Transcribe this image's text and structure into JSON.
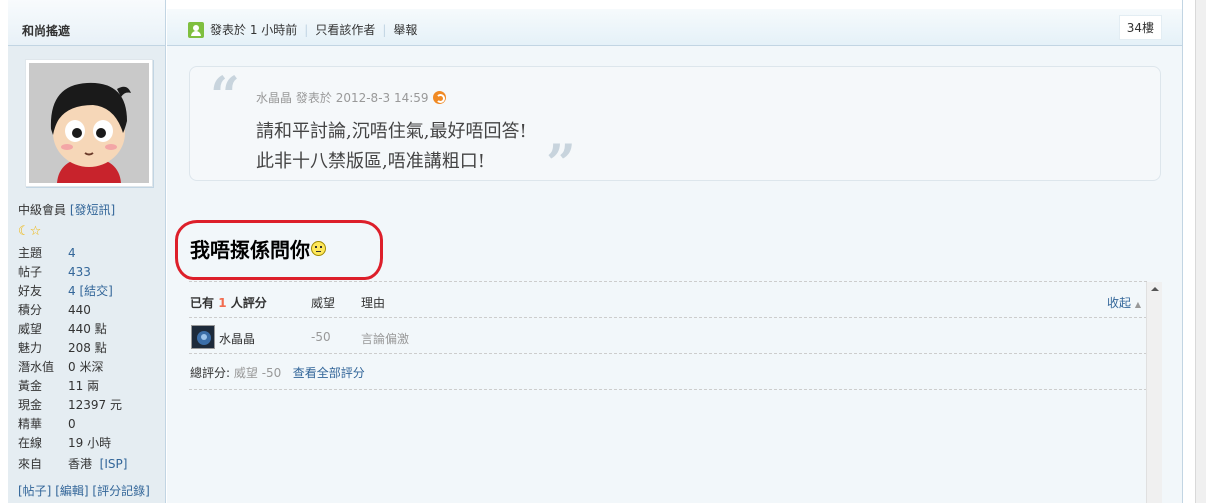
{
  "author": {
    "name": "和尚搖遮",
    "rank": "中級會員",
    "pm_link": "[發短訊]",
    "stats": [
      {
        "key": "主題",
        "value": "4",
        "link": true
      },
      {
        "key": "帖子",
        "value": "433",
        "link": true
      },
      {
        "key": "好友",
        "value": "4",
        "link": true,
        "extra": "[結交]"
      },
      {
        "key": "積分",
        "value": "440",
        "link": false
      },
      {
        "key": "威望",
        "value": "440 點",
        "link": false
      },
      {
        "key": "魅力",
        "value": "208 點",
        "link": false
      },
      {
        "key": "潛水值",
        "value": "0 米深",
        "link": false
      },
      {
        "key": "黃金",
        "value": "11 兩",
        "link": false
      },
      {
        "key": "現金",
        "value": "12397 元",
        "link": false
      },
      {
        "key": "精華",
        "value": "0",
        "link": false
      },
      {
        "key": "在線",
        "value": "19 小時",
        "link": false
      }
    ],
    "from_label": "來自",
    "from_value": "香港",
    "from_link": "[ISP]",
    "actions": [
      "[帖子]",
      "[編輯]",
      "[評分記錄]"
    ]
  },
  "post_header": {
    "posted": "發表於 1 小時前",
    "only_author": "只看該作者",
    "report": "舉報",
    "floor": "34樓"
  },
  "quote": {
    "open_mark": "“",
    "close_mark": "”",
    "author": "水晶晶",
    "posted_label": "發表於",
    "time": "2012-8-3 14:59",
    "line1": "請和平討論,沉唔住氣,最好唔回答!",
    "line2": "此非十八禁版區,唔准講粗口!"
  },
  "message": "我唔揼係問你",
  "rating": {
    "head_prefix": "已有",
    "head_count": "1",
    "head_suffix": "人評分",
    "col_prestige": "威望",
    "col_reason": "理由",
    "collapse": "收起",
    "rows": [
      {
        "user": "水晶晶",
        "value": "-50",
        "reason": "言論偏激"
      }
    ],
    "total_label": "總評分:",
    "total_value": "威望 -50",
    "view_all": "查看全部評分"
  }
}
